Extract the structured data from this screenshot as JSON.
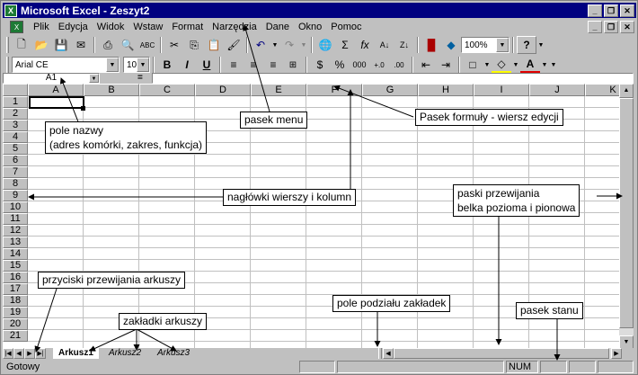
{
  "window": {
    "title": "Microsoft Excel - Zeszyt2",
    "app_icon": "excel-icon"
  },
  "menu": {
    "items": [
      "Plik",
      "Edycja",
      "Widok",
      "Wstaw",
      "Format",
      "Narzędzia",
      "Dane",
      "Okno",
      "Pomoc"
    ]
  },
  "toolbar": {
    "zoom": "100%",
    "font": "Arial CE",
    "size": "10",
    "bold": "B",
    "italic": "I",
    "underline": "U",
    "percent": "%",
    "thousands": "000",
    "currency": "$",
    "sum": "Σ",
    "function": "fx",
    "help": "?",
    "font_color_label": "A"
  },
  "formula_bar": {
    "name_box": "A1",
    "equals": "="
  },
  "grid": {
    "columns": [
      "A",
      "B",
      "C",
      "D",
      "E",
      "F",
      "G",
      "H",
      "I",
      "J",
      "K"
    ],
    "rows": [
      "1",
      "2",
      "3",
      "4",
      "5",
      "6",
      "7",
      "8",
      "9",
      "10",
      "11",
      "12",
      "13",
      "14",
      "15",
      "16",
      "17",
      "18",
      "19",
      "20",
      "21"
    ]
  },
  "sheets": {
    "tabs": [
      "Arkusz1",
      "Arkusz2",
      "Arkusz3"
    ],
    "active": "Arkusz1"
  },
  "status": {
    "text": "Gotowy",
    "num": "NUM"
  },
  "annotations": {
    "pole_nazwy_1": "pole nazwy",
    "pole_nazwy_2": "(adres komórki, zakres, funkcja)",
    "pasek_menu": "pasek menu",
    "pasek_formuly": "Pasek formuły - wiersz edycji",
    "naglowki": "nagłówki wierszy i kolumn",
    "paski_1": "paski przewijania",
    "paski_2": "belka pozioma i pionowa",
    "przyciski": "przyciski przewijania arkuszy",
    "zakladki": "zakładki arkuszy",
    "pole_podzialu": "pole podziału zakładek",
    "pasek_stanu": "pasek stanu"
  },
  "colors": {
    "titlebar": "#000080",
    "face": "#c0c0c0",
    "grid_line": "#c0c0c0",
    "cell_bg": "#ffffff"
  }
}
